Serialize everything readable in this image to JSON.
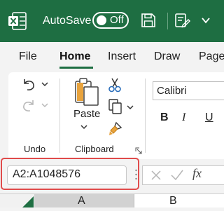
{
  "titlebar": {
    "autosave_label": "AutoSave",
    "autosave_state": "Off"
  },
  "tabs": {
    "file": "File",
    "home": "Home",
    "insert": "Insert",
    "draw": "Draw",
    "page": "Page"
  },
  "ribbon": {
    "undo_group_label": "Undo",
    "paste_label": "Paste",
    "clipboard_group_label": "Clipboard",
    "font_name": "Calibri",
    "bold": "B",
    "italic": "I",
    "underline": "U"
  },
  "formula_bar": {
    "name_box": "A2:A1048576",
    "fx": "fx"
  },
  "columns": {
    "a": "A",
    "b": "B"
  },
  "colors": {
    "title_bar": "#1e6e42",
    "highlight": "#e04b4b"
  }
}
